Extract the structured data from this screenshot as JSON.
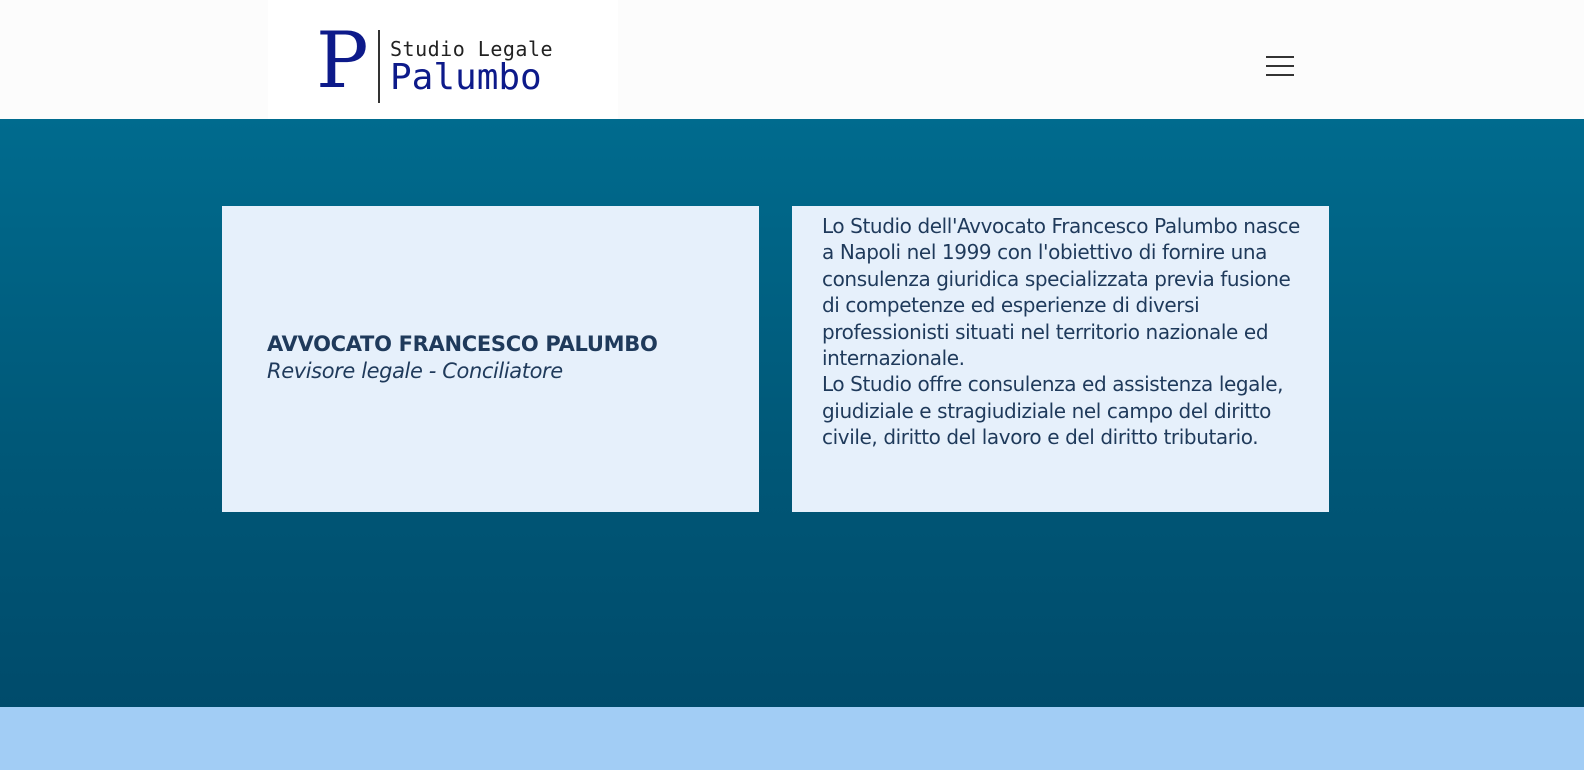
{
  "header": {
    "logo": {
      "mark": "P",
      "line1": "Studio Legale",
      "line2": "Palumbo"
    },
    "menu_icon": "hamburger-menu-icon"
  },
  "hero": {
    "profile_card": {
      "name": "AVVOCATO FRANCESCO PALUMBO",
      "role": "Revisore legale - Conciliatore"
    },
    "intro_card": {
      "paragraph1": "Lo Studio dell'Avvocato Francesco Palumbo nasce a Napoli nel 1999 con l'obiettivo di fornire una consulenza giuridica specializzata previa fusione di competenze ed esperienze di diversi professionisti situati nel territorio nazionale ed internazionale.",
      "paragraph2": "Lo Studio offre consulenza ed assistenza legale, giudiziale e stragiudiziale nel campo del diritto civile, diritto del lavoro e del diritto tributario."
    }
  },
  "colors": {
    "hero_top": "#006b8e",
    "hero_bottom": "#004b6b",
    "card_background": "#e6f0fb",
    "text_dark_blue": "#1f3a5b",
    "logo_blue": "#0d1a8a",
    "footer_band": "#a2cdf5"
  }
}
